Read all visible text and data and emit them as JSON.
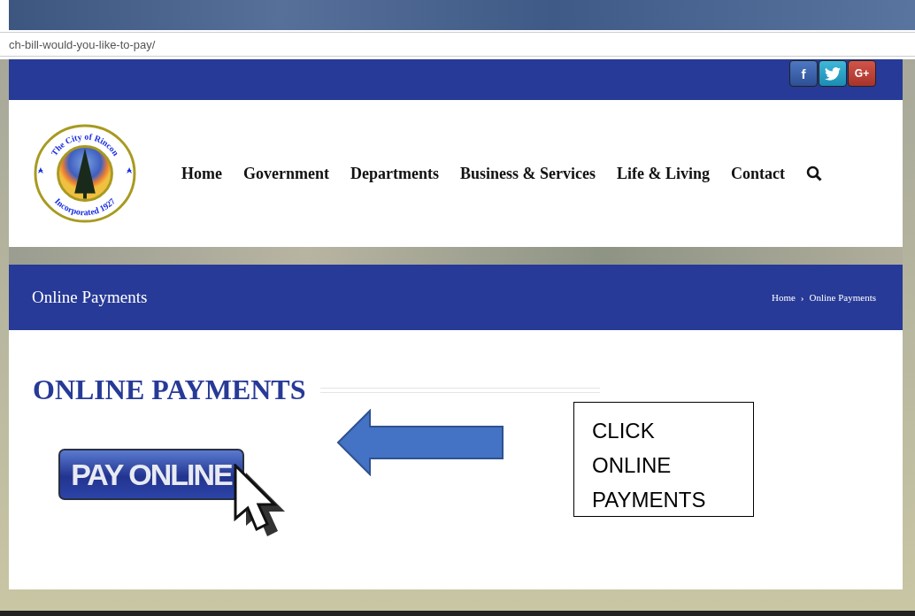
{
  "address_bar": {
    "url": "ch-bill-would-you-like-to-pay/"
  },
  "social_icons": [
    {
      "kind": "facebook",
      "label": "f"
    },
    {
      "kind": "twitter"
    },
    {
      "kind": "googleplus",
      "label": "G+"
    }
  ],
  "logo": {
    "top_text": "The City of Rincon",
    "bottom_text": "Incorporated 1927"
  },
  "nav": {
    "items": [
      "Home",
      "Government",
      "Departments",
      "Business & Services",
      "Life & Living",
      "Contact"
    ]
  },
  "page_title": {
    "title": "Online Payments",
    "breadcrumb": [
      {
        "label": "Home"
      },
      {
        "label": "Online Payments"
      }
    ],
    "separator": "›"
  },
  "content": {
    "heading": "ONLINE PAYMENTS",
    "pay_button": "PAY ONLINE",
    "callout": [
      "CLICK",
      "ONLINE",
      "PAYMENTS"
    ]
  }
}
